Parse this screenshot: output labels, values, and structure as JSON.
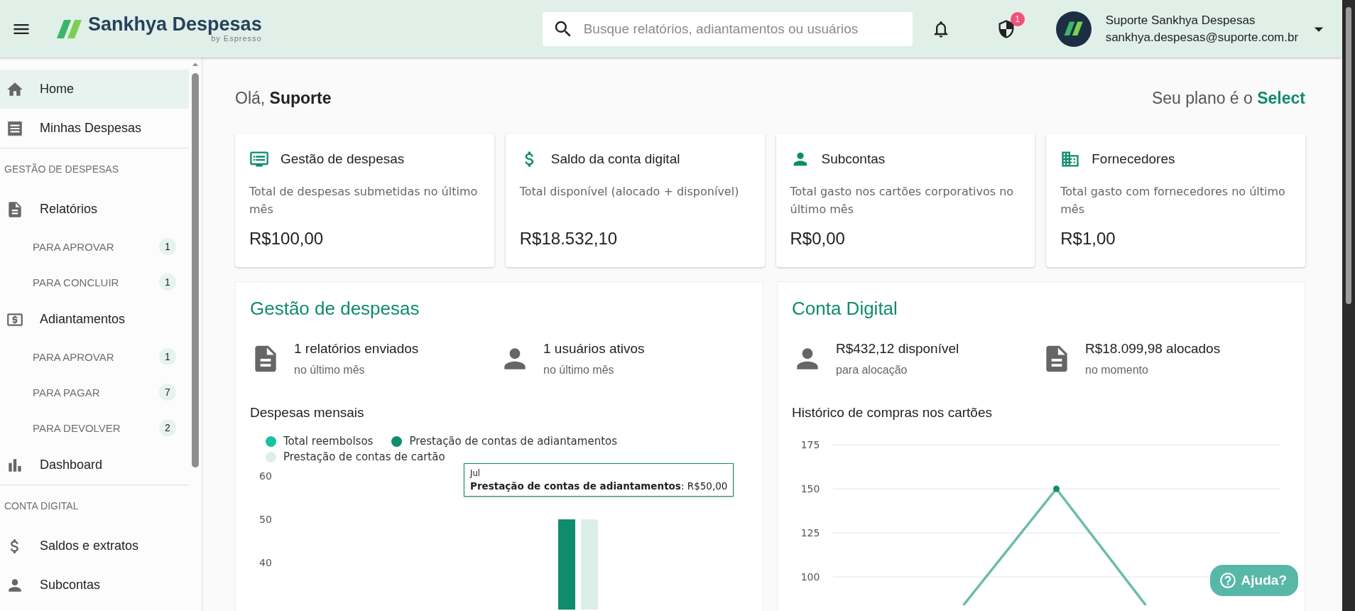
{
  "header": {
    "logo": {
      "name": "Sankhya Despesas",
      "tagline": "by Espresso"
    },
    "search": {
      "placeholder": "Busque relatórios, adiantamentos ou usuários"
    },
    "alerts_badge": "1",
    "user": {
      "name": "Suporte Sankhya Despesas",
      "email": "sankhya.despesas@suporte.com.br"
    }
  },
  "sidebar": {
    "items": [
      {
        "kind": "item",
        "label": "Home",
        "selected": true
      },
      {
        "kind": "item",
        "label": "Minhas Despesas",
        "selected": false
      },
      {
        "kind": "section",
        "label": "GESTÃO DE DESPESAS"
      },
      {
        "kind": "item",
        "label": "Relatórios",
        "selected": false
      },
      {
        "kind": "subitem",
        "label": "PARA APROVAR",
        "count": "1",
        "selected": false
      },
      {
        "kind": "subitem",
        "label": "PARA CONCLUIR",
        "count": "1",
        "selected": false
      },
      {
        "kind": "item",
        "label": "Adiantamentos",
        "selected": false
      },
      {
        "kind": "subitem",
        "label": "PARA APROVAR",
        "count": "1",
        "selected": false
      },
      {
        "kind": "subitem",
        "label": "PARA PAGAR",
        "count": "7",
        "selected": false
      },
      {
        "kind": "subitem",
        "label": "PARA DEVOLVER",
        "count": "2",
        "selected": false
      },
      {
        "kind": "item",
        "label": "Dashboard",
        "selected": false
      },
      {
        "kind": "section",
        "label": "CONTA DIGITAL"
      },
      {
        "kind": "item",
        "label": "Saldos e extratos",
        "selected": false
      },
      {
        "kind": "item",
        "label": "Subcontas",
        "selected": false
      }
    ]
  },
  "greeting": "Olá, **Suporte**",
  "plan": "Seu plano é o **Select**",
  "cards": [
    {
      "title": "Gestão de despesas",
      "description": "Total de despesas submetidas no último mês",
      "value": "R$100,00"
    },
    {
      "title": "Saldo da conta digital",
      "description": "Total disponível (alocado + disponível)",
      "value": "R$18.532,10"
    },
    {
      "title": "Subcontas",
      "description": "Total gasto nos cartões corporativos no último mês",
      "value": "R$0,00"
    },
    {
      "title": "Fornecedores",
      "description": "Total gasto com fornecedores no último mês",
      "value": "R$1,00"
    }
  ],
  "panels": [
    {
      "title": "Gestão de despesas",
      "stats": [
        {
          "value": "1 relatórios enviados",
          "caption": "no último mês"
        },
        {
          "value": "1 usuários ativos",
          "caption": "no último mês"
        }
      ],
      "chart_title": "Despesas mensais",
      "tooltip": {
        "label": "Jul",
        "text": "**Prestação de contas de adiantamentos**: R$50,00"
      },
      "legend": [
        {
          "name": "Total reembolsos",
          "color": "#17c29e"
        },
        {
          "name": "Prestação de contas de adiantamentos",
          "color": "#0f8c6c"
        },
        {
          "name": "Prestação de contas de cartão",
          "color": "#dceee8"
        }
      ],
      "bar_chart": {
        "y_axis_labels": [
          "60",
          "50",
          "40"
        ]
      }
    },
    {
      "title": "Conta Digital",
      "stats": [
        {
          "value": "R$432,12 disponível",
          "caption": "para alocação"
        },
        {
          "value": "R$18.099,98 alocados",
          "caption": "no momento"
        }
      ],
      "chart_title": "Histórico de compras nos cartões",
      "line_chart": {
        "y_axis_labels": [
          "175",
          "150",
          "125",
          "100"
        ]
      }
    }
  ],
  "help_button": "Ajuda?"
}
